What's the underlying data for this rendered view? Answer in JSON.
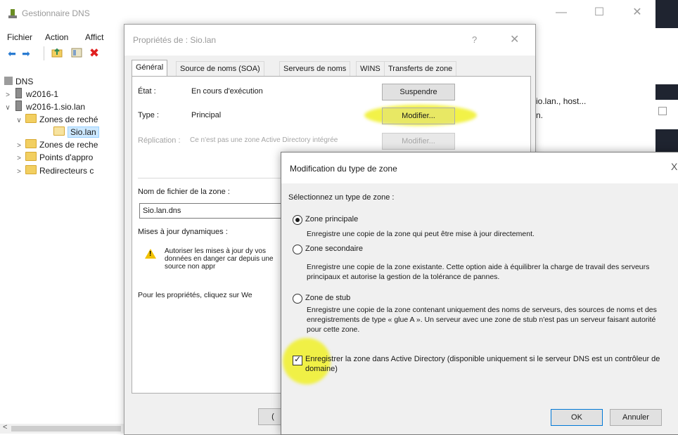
{
  "main_window": {
    "title": "Gestionnaire DNS",
    "menu": [
      "Fichier",
      "Action",
      "Affict"
    ],
    "window_controls": {
      "minimize": "—",
      "maximize": "☐",
      "close": "✕"
    }
  },
  "tree": {
    "root": "DNS",
    "server1": "w2016-1",
    "server2": "w2016-1.sio.lan",
    "zones_forward": "Zones de reché",
    "selected_zone": "Sio.lan",
    "zones_reverse": "Zones de reche",
    "trust_points": "Points d'appro",
    "forwarders": "Redirecteurs c"
  },
  "right_pane": {
    "line1": "io.lan., host...",
    "line2": "n."
  },
  "properties_dialog": {
    "title": "Propriétés de : Sio.lan",
    "help": "?",
    "close": "✕",
    "tabs": [
      "Général",
      "Source de noms (SOA)",
      "Serveurs de noms",
      "WINS",
      "Transferts de zone"
    ],
    "status_label": "État :",
    "status_value": "En cours d'exécution",
    "suspend_button": "Suspendre",
    "type_label": "Type :",
    "type_value": "Principal",
    "modify_button": "Modifier...",
    "replication_label": "Réplication :",
    "replication_value": "Ce n'est pas une zone Active Directory intégrée",
    "replication_button": "Modifier...",
    "zone_file_label": "Nom de fichier de la zone :",
    "zone_file_value": "Sio.lan.dns",
    "dynamic_updates_label": "Mises à jour dynamiques :",
    "warning_text": "Autoriser les mises à jour dy vos données en danger car depuis une source non appr",
    "properties_note": "Pour les propriétés, cliquez sur We",
    "bottom_button": "("
  },
  "modify_dialog": {
    "title": "Modification du type de zone",
    "close": "X",
    "prompt": "Sélectionnez un type de zone :",
    "options": [
      {
        "label": "Zone principale",
        "selected": true,
        "description": "Enregistre une copie de la zone qui peut être mise à jour directement."
      },
      {
        "label": "Zone secondaire",
        "selected": false,
        "description": "Enregistre une copie de la zone existante. Cette option aide à équilibrer la charge de travail des serveurs principaux et autorise la gestion de la tolérance de pannes."
      },
      {
        "label": "Zone de stub",
        "selected": false,
        "description": "Enregistre une copie de la zone contenant uniquement des noms de serveurs, des sources de noms et des enregistrements de type « glue A ». Un serveur avec une zone de stub n'est pas un serveur faisant autorité pour cette zone."
      }
    ],
    "ad_checkbox_label": "Enregistrer la zone dans Active Directory (disponible uniquement si le serveur DNS est un contrôleur de domaine)",
    "ad_checkbox_checked": true,
    "ok_button": "OK",
    "cancel_button": "Annuler"
  },
  "scrollbar": {
    "left_arrow": "<"
  },
  "colors": {
    "highlight": "#f0f028",
    "selection": "#cce8ff",
    "ok_border": "#0078d7"
  }
}
